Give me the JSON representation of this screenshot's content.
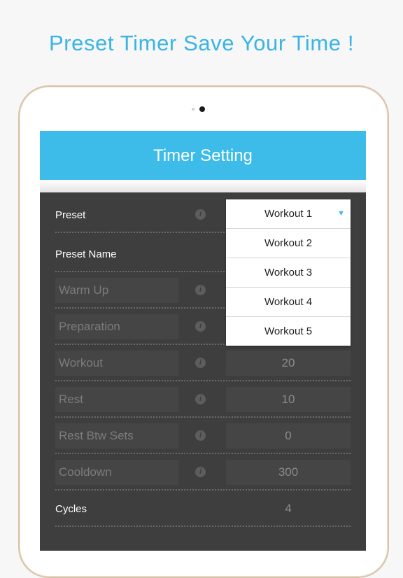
{
  "headline": "Preset Timer Save Your Time !",
  "screen": {
    "title": "Timer Setting",
    "preset": {
      "label": "Preset",
      "selected": "Workout 1",
      "options": [
        "Workout 2",
        "Workout 3",
        "Workout 4",
        "Workout 5"
      ]
    },
    "preset_name": {
      "label": "Preset Name"
    },
    "rows": [
      {
        "label": "Warm Up",
        "value": ""
      },
      {
        "label": "Preparation",
        "value": ""
      },
      {
        "label": "Workout",
        "value": "20"
      },
      {
        "label": "Rest",
        "value": "10"
      },
      {
        "label": "Rest Btw Sets",
        "value": "0"
      },
      {
        "label": "Cooldown",
        "value": "300"
      }
    ],
    "cycles": {
      "label": "Cycles",
      "value": "4"
    }
  },
  "colors": {
    "accent": "#3dbce9",
    "headline": "#3ab4e4",
    "panel": "#3e3e3e"
  }
}
